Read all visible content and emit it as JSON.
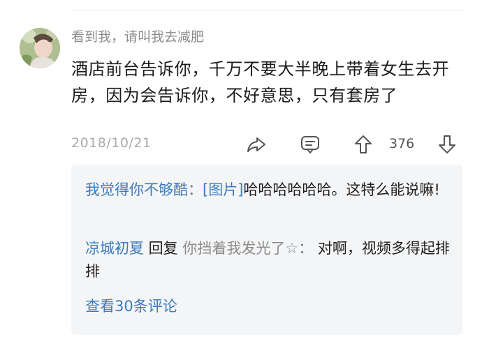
{
  "comment": {
    "username": "看到我，请叫我去减肥",
    "text": "酒店前台告诉你，千万不要大半晚上带着女生去开房，因为会告诉你，不好意思，只有套房了",
    "date": "2018/10/21",
    "vote_count": "376",
    "icons": [
      "share-icon",
      "comment-icon",
      "upvote-icon",
      "downvote-icon"
    ]
  },
  "replies": [
    {
      "author": "我觉得你不够酷",
      "colon": "：",
      "image_tag": "[图片]",
      "content": "哈哈哈哈哈哈。这特么能说嘛!"
    },
    {
      "author": "凉城初夏",
      "reply_word": " 回复 ",
      "target": "你挡着我发光了☆",
      "colon": "： ",
      "content": "对啊，视频多得起排排"
    }
  ],
  "view_more": "查看30条评论",
  "colors": {
    "link": "#3a7bbd",
    "muted": "#8b8b8b",
    "reply_bg": "#f4f5f7"
  }
}
